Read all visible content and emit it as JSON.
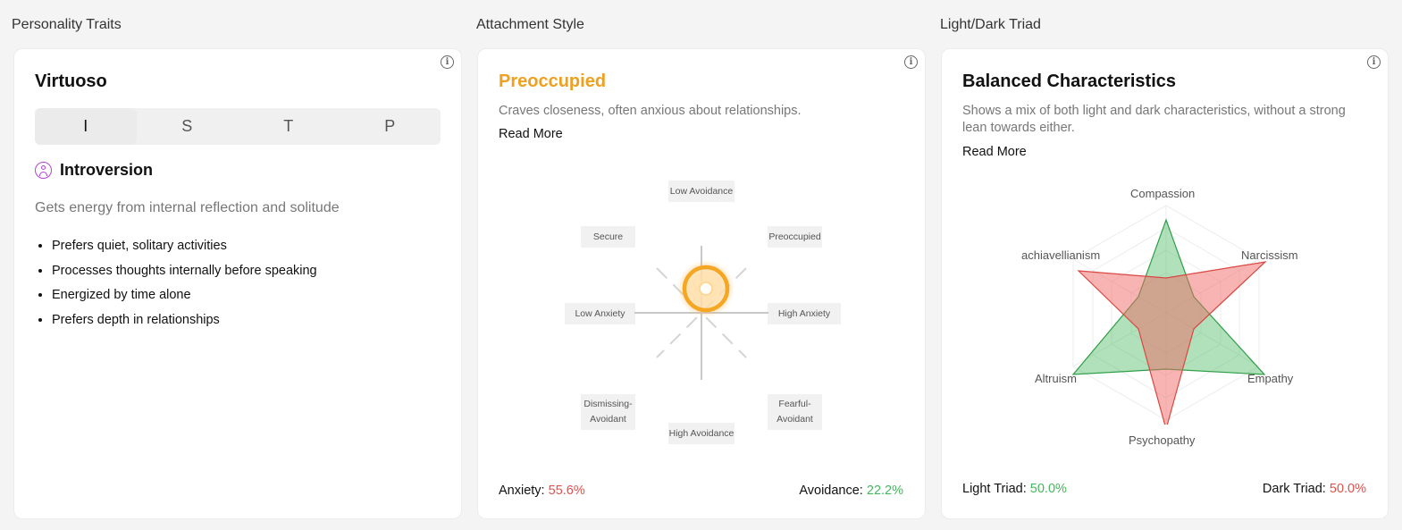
{
  "sections": {
    "personality": "Personality Traits",
    "attachment": "Attachment Style",
    "triad": "Light/Dark Triad"
  },
  "personality": {
    "title": "Virtuoso",
    "tabs": [
      "I",
      "S",
      "T",
      "P"
    ],
    "active_tab": 0,
    "trait_icon": "user-circle-icon",
    "trait_name": "Introversion",
    "description": "Gets energy from internal reflection and solitude",
    "bullets": [
      "Prefers quiet, solitary activities",
      "Processes thoughts internally before speaking",
      "Energized by time alone",
      "Prefers depth in relationships"
    ]
  },
  "attachment": {
    "title": "Preoccupied",
    "title_color": "#f0a020",
    "description": "Craves closeness, often anxious about relationships.",
    "read_more": "Read More",
    "labels": {
      "top": "Low Avoidance",
      "top_left": "Secure",
      "top_right": "Preoccupied",
      "left": "Low Anxiety",
      "right": "High Anxiety",
      "bottom_left_1": "Dismissing-",
      "bottom_left_2": "Avoidant",
      "bottom_right_1": "Fearful-",
      "bottom_right_2": "Avoidant",
      "bottom": "High Avoidance"
    },
    "anxiety_label": "Anxiety:",
    "anxiety_value": "55.6%",
    "avoidance_label": "Avoidance:",
    "avoidance_value": "22.2%"
  },
  "triad": {
    "title": "Balanced Characteristics",
    "description": "Shows a mix of both light and dark characteristics, without a strong lean towards either.",
    "read_more": "Read More",
    "axes": {
      "top": "Compassion",
      "top_right": "Narcissism",
      "bottom_right": "Empathy",
      "bottom": "Psychopathy",
      "bottom_left": "Altruism",
      "top_left": "achiavellianism"
    },
    "light_label": "Light Triad:",
    "light_value": "50.0%",
    "dark_label": "Dark Triad:",
    "dark_value": "50.0%",
    "light_color": "#43b85c",
    "dark_color": "#e0504c"
  }
}
